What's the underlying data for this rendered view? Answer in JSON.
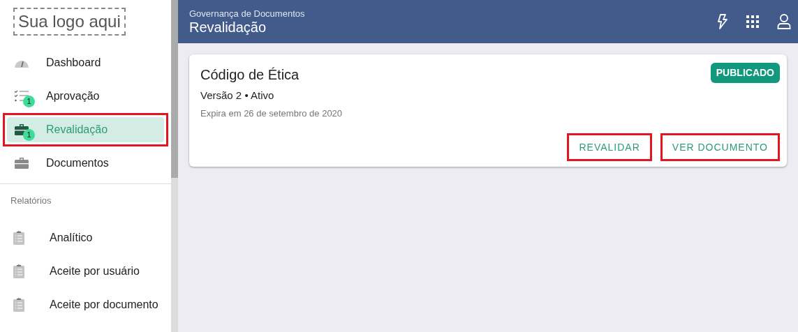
{
  "logo": {
    "text": "Sua logo aqui"
  },
  "nav": [
    {
      "kind": "gauge",
      "label": "Dashboard",
      "selected": false,
      "highlighted": false
    },
    {
      "kind": "checklist",
      "label": "Aprovação",
      "badge": "1",
      "selected": false,
      "highlighted": false
    },
    {
      "kind": "briefcase",
      "label": "Revalidação",
      "badge": "1",
      "selected": true,
      "highlighted": true
    },
    {
      "kind": "briefcase",
      "label": "Documentos",
      "selected": false,
      "highlighted": false
    }
  ],
  "reports": {
    "heading": "Relatórios",
    "items": [
      {
        "label": "Analítico"
      },
      {
        "label": "Aceite por usuário"
      },
      {
        "label": "Aceite por documento"
      }
    ]
  },
  "header": {
    "subtitle": "Governança de Documentos",
    "title": "Revalidação"
  },
  "card": {
    "title": "Código de Ética",
    "meta": "Versão 2 • Ativo",
    "expiry": "Expira em 26 de setembro de 2020",
    "status": "PUBLICADO",
    "actions": [
      {
        "label": "REVALIDAR",
        "highlighted": true
      },
      {
        "label": "VER DOCUMENTO",
        "highlighted": true
      }
    ]
  }
}
